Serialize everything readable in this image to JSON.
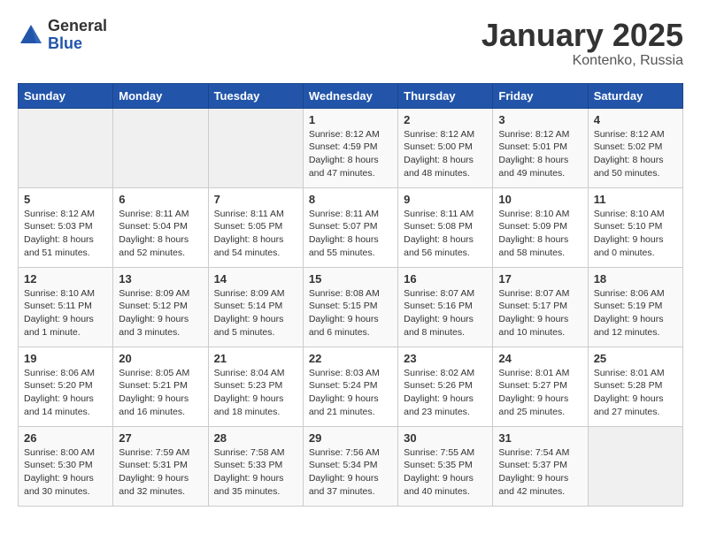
{
  "header": {
    "logo_general": "General",
    "logo_blue": "Blue",
    "title": "January 2025",
    "subtitle": "Kontenko, Russia"
  },
  "days_of_week": [
    "Sunday",
    "Monday",
    "Tuesday",
    "Wednesday",
    "Thursday",
    "Friday",
    "Saturday"
  ],
  "weeks": [
    [
      {
        "day": "",
        "info": ""
      },
      {
        "day": "",
        "info": ""
      },
      {
        "day": "",
        "info": ""
      },
      {
        "day": "1",
        "info": "Sunrise: 8:12 AM\nSunset: 4:59 PM\nDaylight: 8 hours and 47 minutes."
      },
      {
        "day": "2",
        "info": "Sunrise: 8:12 AM\nSunset: 5:00 PM\nDaylight: 8 hours and 48 minutes."
      },
      {
        "day": "3",
        "info": "Sunrise: 8:12 AM\nSunset: 5:01 PM\nDaylight: 8 hours and 49 minutes."
      },
      {
        "day": "4",
        "info": "Sunrise: 8:12 AM\nSunset: 5:02 PM\nDaylight: 8 hours and 50 minutes."
      }
    ],
    [
      {
        "day": "5",
        "info": "Sunrise: 8:12 AM\nSunset: 5:03 PM\nDaylight: 8 hours and 51 minutes."
      },
      {
        "day": "6",
        "info": "Sunrise: 8:11 AM\nSunset: 5:04 PM\nDaylight: 8 hours and 52 minutes."
      },
      {
        "day": "7",
        "info": "Sunrise: 8:11 AM\nSunset: 5:05 PM\nDaylight: 8 hours and 54 minutes."
      },
      {
        "day": "8",
        "info": "Sunrise: 8:11 AM\nSunset: 5:07 PM\nDaylight: 8 hours and 55 minutes."
      },
      {
        "day": "9",
        "info": "Sunrise: 8:11 AM\nSunset: 5:08 PM\nDaylight: 8 hours and 56 minutes."
      },
      {
        "day": "10",
        "info": "Sunrise: 8:10 AM\nSunset: 5:09 PM\nDaylight: 8 hours and 58 minutes."
      },
      {
        "day": "11",
        "info": "Sunrise: 8:10 AM\nSunset: 5:10 PM\nDaylight: 9 hours and 0 minutes."
      }
    ],
    [
      {
        "day": "12",
        "info": "Sunrise: 8:10 AM\nSunset: 5:11 PM\nDaylight: 9 hours and 1 minute."
      },
      {
        "day": "13",
        "info": "Sunrise: 8:09 AM\nSunset: 5:12 PM\nDaylight: 9 hours and 3 minutes."
      },
      {
        "day": "14",
        "info": "Sunrise: 8:09 AM\nSunset: 5:14 PM\nDaylight: 9 hours and 5 minutes."
      },
      {
        "day": "15",
        "info": "Sunrise: 8:08 AM\nSunset: 5:15 PM\nDaylight: 9 hours and 6 minutes."
      },
      {
        "day": "16",
        "info": "Sunrise: 8:07 AM\nSunset: 5:16 PM\nDaylight: 9 hours and 8 minutes."
      },
      {
        "day": "17",
        "info": "Sunrise: 8:07 AM\nSunset: 5:17 PM\nDaylight: 9 hours and 10 minutes."
      },
      {
        "day": "18",
        "info": "Sunrise: 8:06 AM\nSunset: 5:19 PM\nDaylight: 9 hours and 12 minutes."
      }
    ],
    [
      {
        "day": "19",
        "info": "Sunrise: 8:06 AM\nSunset: 5:20 PM\nDaylight: 9 hours and 14 minutes."
      },
      {
        "day": "20",
        "info": "Sunrise: 8:05 AM\nSunset: 5:21 PM\nDaylight: 9 hours and 16 minutes."
      },
      {
        "day": "21",
        "info": "Sunrise: 8:04 AM\nSunset: 5:23 PM\nDaylight: 9 hours and 18 minutes."
      },
      {
        "day": "22",
        "info": "Sunrise: 8:03 AM\nSunset: 5:24 PM\nDaylight: 9 hours and 21 minutes."
      },
      {
        "day": "23",
        "info": "Sunrise: 8:02 AM\nSunset: 5:26 PM\nDaylight: 9 hours and 23 minutes."
      },
      {
        "day": "24",
        "info": "Sunrise: 8:01 AM\nSunset: 5:27 PM\nDaylight: 9 hours and 25 minutes."
      },
      {
        "day": "25",
        "info": "Sunrise: 8:01 AM\nSunset: 5:28 PM\nDaylight: 9 hours and 27 minutes."
      }
    ],
    [
      {
        "day": "26",
        "info": "Sunrise: 8:00 AM\nSunset: 5:30 PM\nDaylight: 9 hours and 30 minutes."
      },
      {
        "day": "27",
        "info": "Sunrise: 7:59 AM\nSunset: 5:31 PM\nDaylight: 9 hours and 32 minutes."
      },
      {
        "day": "28",
        "info": "Sunrise: 7:58 AM\nSunset: 5:33 PM\nDaylight: 9 hours and 35 minutes."
      },
      {
        "day": "29",
        "info": "Sunrise: 7:56 AM\nSunset: 5:34 PM\nDaylight: 9 hours and 37 minutes."
      },
      {
        "day": "30",
        "info": "Sunrise: 7:55 AM\nSunset: 5:35 PM\nDaylight: 9 hours and 40 minutes."
      },
      {
        "day": "31",
        "info": "Sunrise: 7:54 AM\nSunset: 5:37 PM\nDaylight: 9 hours and 42 minutes."
      },
      {
        "day": "",
        "info": ""
      }
    ]
  ]
}
